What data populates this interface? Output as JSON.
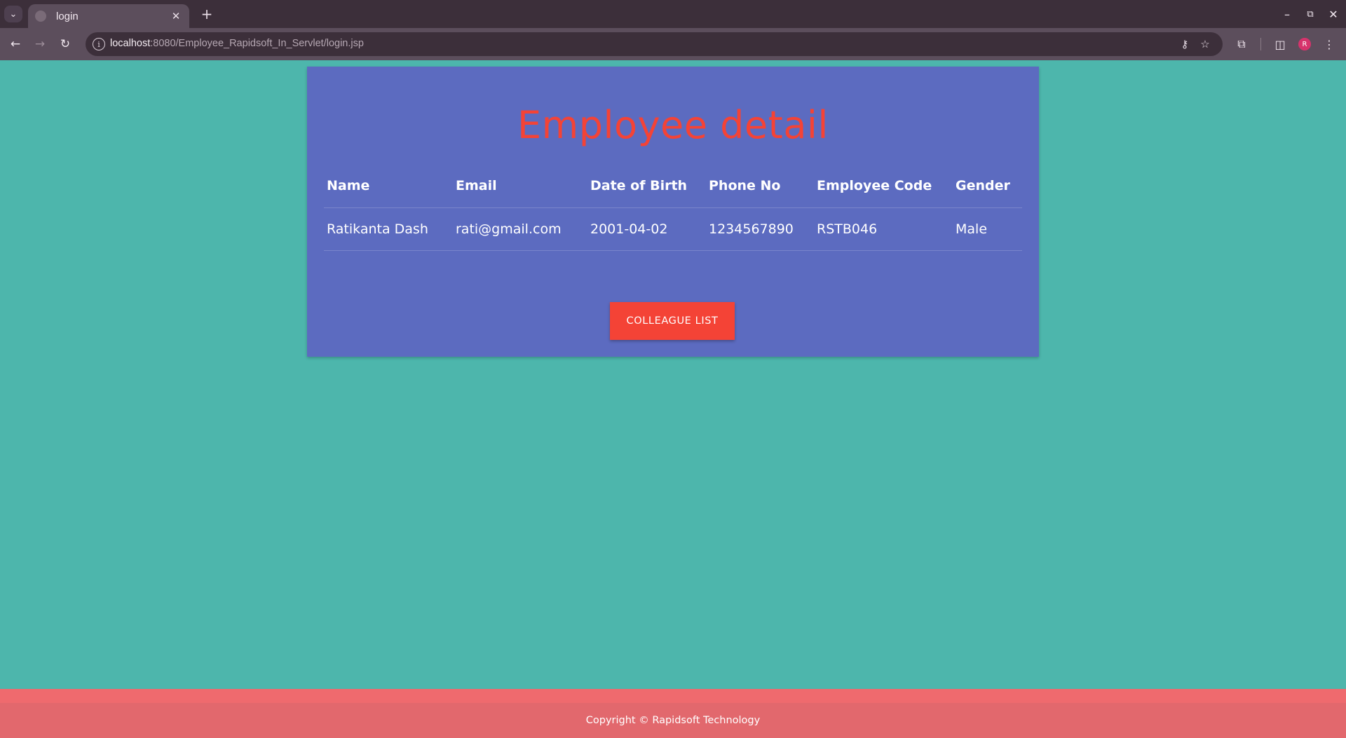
{
  "browser": {
    "tab_title": "login",
    "url_host": "localhost",
    "url_path": ":8080/Employee_Rapidsoft_In_Servlet/login.jsp",
    "profile_initial": "R",
    "icons": {
      "tab_list": "chevron-down-icon",
      "favicon": "globe-icon",
      "close": "close-icon",
      "new_tab": "plus-icon",
      "back": "arrow-left-icon",
      "forward": "arrow-right-icon",
      "reload": "reload-icon",
      "site_info": "info-icon",
      "password": "key-icon",
      "bookmark": "star-icon",
      "extensions": "puzzle-icon",
      "side_panel": "side-panel-icon",
      "menu": "kebab-menu-icon"
    }
  },
  "page": {
    "title": "Employee detail",
    "table": {
      "headers": [
        "Name",
        "Email",
        "Date of Birth",
        "Phone No",
        "Employee Code",
        "Gender"
      ],
      "rows": [
        [
          "Ratikanta Dash",
          "rati@gmail.com",
          "2001-04-02",
          "1234567890",
          "RSTB046",
          "Male"
        ]
      ]
    },
    "button_label": "COLLEAGUE LIST"
  },
  "footer": {
    "text": "Copyright © Rapidsoft Technology"
  },
  "colors": {
    "background": "#4db6ac",
    "card": "#5c6bc0",
    "accent": "#f44336",
    "footer": "#e2686d"
  }
}
